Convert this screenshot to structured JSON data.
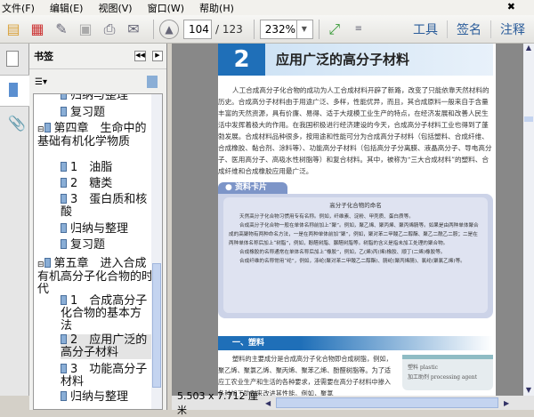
{
  "menu": [
    "文件(F)",
    "编辑(E)",
    "视图(V)",
    "窗口(W)",
    "帮助(H)"
  ],
  "toolbar": {
    "page_current": "104",
    "page_total": "/ 123",
    "zoom": "232%",
    "tools": "工具",
    "sign": "签名",
    "comment": "注释"
  },
  "panel": {
    "title": "书签"
  },
  "bookmarks": [
    {
      "label": "归纳与整理",
      "level": 2
    },
    {
      "label": "复习题",
      "level": 2
    },
    {
      "label": "第四章　生命中的基础有机化学物质",
      "level": 1
    },
    {
      "label": "1　油脂",
      "level": 2
    },
    {
      "label": "2　糖类",
      "level": 2
    },
    {
      "label": "3　蛋白质和核酸",
      "level": 2
    },
    {
      "label": "归纳与整理",
      "level": 2
    },
    {
      "label": "复习题",
      "level": 2
    },
    {
      "label": "第五章　进入合成有机高分子化合物的时代",
      "level": 1
    },
    {
      "label": "1　合成高分子化合物的基本方法",
      "level": 2
    },
    {
      "label": "2　应用广泛的高分子材料",
      "level": 2,
      "selected": true
    },
    {
      "label": "3　功能高分子材料",
      "level": 2
    },
    {
      "label": "归纳与整理",
      "level": 2
    }
  ],
  "page": {
    "number": "2",
    "title": "应用广泛的高分子材料",
    "intro": "人工合成高分子化合物的成功为人工合成材料开辟了新路，改变了只能依靠天然材料的历史。合成高分子材料由于用途广泛、多样，性能优异，而且，其合成原料一般来自于含量丰富的天然资源，具有价廉、易得、适于大规模工业生产的特点，在经济发展和改善人民生活中发挥着极大的作用。在我国积极进行经济建设的今天，合成高分子材料工业也得到了蓬勃发展。合成材料品种很多，按用途和性能可分为合成高分子材料（包括塑料、合成纤维、合成橡胶、黏合剂、涂料等）、功能高分子材料（包括高分子分离膜、液晶高分子、导电高分子、医用高分子、高吸水性树脂等）和复合材料。其中，被称为“三大合成材料”的塑料、合成纤维和合成橡胶应用最广泛。",
    "card_tab": "资料卡片",
    "card_title": "高分子化合物的命名",
    "card_paras": [
      "天然高分子化合物习惯用专有名称。例如，纤维素、淀粉、甲壳质、蛋白质等。",
      "合成高分子化合物一般在单体名称前加上“聚”。例如，聚乙烯、聚丙烯、聚丙烯腈等。如果是由两种单体聚合成的高聚物有两种命名方法，一是在两种单体前加“聚”，例如，聚对苯二甲酸乙二醇酯、聚乙二酰乙二胺；二是在两种单体名称后加上“树脂”，例如，酚醛树脂、脲醛树脂等。树脂的含义是指未加工处理的聚合物。",
      "合成橡胶的名称通常在单体名称后加上“橡胶”，例如，乙(烯)丙(烯)橡胶、顺丁(二烯)橡胶等。",
      "合成纤维的名称常用“纶”，例如，涤纶(聚对苯二甲酸乙二醇酯)、腈纶(聚丙烯腈)、氯纶(聚氯乙烯)等。"
    ],
    "section": "一、塑料",
    "section_para": "塑料的主要成分是合成高分子化合物即合成树脂，例如，聚乙烯、聚氯乙烯、聚丙烯、聚苯乙烯、酚醛树脂等。为了适应工农业生产和生活的各种要求，还需要在高分子材料中掺入各种加工助剂来改进其性能。例如，聚氯",
    "glossary": [
      "塑料 plastic",
      "加工助剂 processing agent"
    ]
  },
  "status": {
    "size": "5.503 x 7.712 厘米"
  }
}
